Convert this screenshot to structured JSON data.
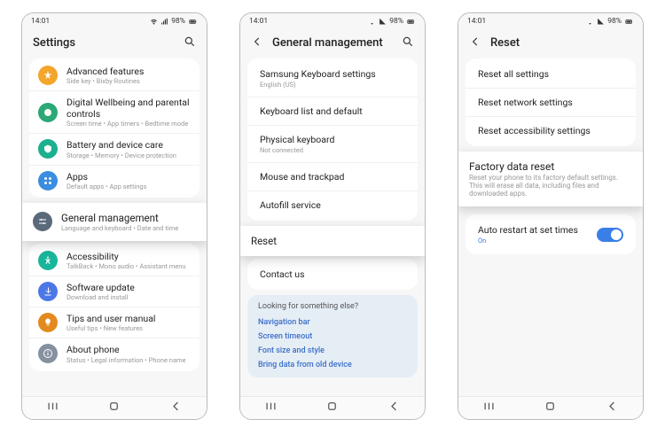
{
  "status": {
    "time": "14:01",
    "battery": "98%"
  },
  "screen1": {
    "title": "Settings",
    "items": [
      {
        "title": "Advanced features",
        "sub": "Side key  •  Bixby Routines",
        "color": "#f4a62a"
      },
      {
        "title": "Digital Wellbeing and parental controls",
        "sub": "Screen time  •  App timers  •  Bedtime mode",
        "color": "#2aa876"
      },
      {
        "title": "Battery and device care",
        "sub": "Storage  •  Memory  •  Device protection",
        "color": "#1bb08f"
      },
      {
        "title": "Apps",
        "sub": "Default apps  •  App settings",
        "color": "#3a8de0"
      }
    ],
    "highlight": {
      "title": "General management",
      "sub": "Language and keyboard  •  Date and time"
    },
    "items2": [
      {
        "title": "Accessibility",
        "sub": "TalkBack  •  Mono audio  •  Assistant menu",
        "color": "#19b59b"
      },
      {
        "title": "Software update",
        "sub": "Download and install",
        "color": "#4b78e6"
      },
      {
        "title": "Tips and user manual",
        "sub": "Useful tips  •  New features",
        "color": "#e38a1e"
      },
      {
        "title": "About phone",
        "sub": "Status  •  Legal information  •  Phone name",
        "color": "#8590a0"
      }
    ]
  },
  "screen2": {
    "title": "General management",
    "rows": [
      {
        "title": "Samsung Keyboard settings",
        "sub": "English (US)"
      },
      {
        "title": "Keyboard list and default",
        "sub": ""
      },
      {
        "title": "Physical keyboard",
        "sub": "Not connected"
      },
      {
        "title": "Mouse and trackpad",
        "sub": ""
      },
      {
        "title": "Autofill service",
        "sub": ""
      }
    ],
    "highlight": {
      "title": "Reset"
    },
    "rows2": [
      {
        "title": "Contact us"
      }
    ],
    "looking": {
      "heading": "Looking for something else?",
      "links": [
        "Navigation bar",
        "Screen timeout",
        "Font size and style",
        "Bring data from old device"
      ]
    }
  },
  "screen3": {
    "title": "Reset",
    "rows": [
      {
        "title": "Reset all settings"
      },
      {
        "title": "Reset network settings"
      },
      {
        "title": "Reset accessibility settings"
      }
    ],
    "highlight": {
      "title": "Factory data reset",
      "sub": "Reset your phone to its factory default settings. This will erase all data, including files and downloaded apps."
    },
    "auto": {
      "title": "Auto restart at set times",
      "sub": "On"
    }
  }
}
